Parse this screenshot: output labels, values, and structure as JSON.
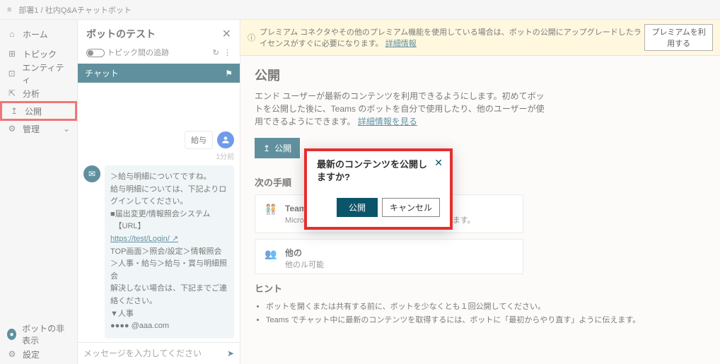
{
  "breadcrumb": "部署1 / 社内Q&Aチャットボット",
  "nav": [
    {
      "icon": "⌂",
      "label": "ホーム"
    },
    {
      "icon": "⊞",
      "label": "トピック"
    },
    {
      "icon": "⊡",
      "label": "エンティティ"
    },
    {
      "icon": "⇱",
      "label": "分析"
    },
    {
      "icon": "↥",
      "label": "公開"
    },
    {
      "icon": "⚙",
      "label": "管理"
    }
  ],
  "nav_bottom": [
    {
      "icon": "●",
      "label": "ボットの非表示"
    },
    {
      "icon": "⚙",
      "label": "設定"
    }
  ],
  "test_panel": {
    "title": "ボットのテスト",
    "track_label": "トピック間の追跡",
    "chat_tab": "チャット",
    "user_msg": "給与",
    "user_ts": "1分前",
    "bot_lines": [
      "＞給与明細についてですね。",
      "給与明細については、下記よりログインしてください。",
      "■届出変更/情報照会システム",
      "　【URL】",
      "https://test/Login/ ↗",
      "TOP画面＞照会/設定＞情報照会＞人事・給与＞給与・賞与明細照会",
      "",
      "解決しない場合は、下記までご連絡ください。",
      "▼人事",
      "●●●● @aaa.com"
    ],
    "input_placeholder": "メッセージを入力してください"
  },
  "banner": {
    "text": "プレミアム コネクタやその他のプレミアム機能を使用している場合は、ボットの公開にアップグレードしたライセンスがすぐに必要になります。",
    "link": "詳細情報",
    "button": "プレミアムを利用する"
  },
  "page": {
    "title": "公開",
    "desc": "エンド ユーザーが最新のコンテンツを利用できるようにします。初めてボットを公開した後に、Teams のボットを自分で使用したり、他のユーザーが使用できるようにできます。",
    "desc_link": "詳細情報を見る",
    "publish_btn": "公開",
    "next_steps": "次の手順",
    "card1_title": "Teams でボットを開く",
    "card1_sub": "Microsoft Teams でボットとのチャットを開始します。",
    "card2_title": "他の",
    "card2_sub": "他のル可能",
    "hints_title": "ヒント",
    "hints": [
      "ボットを開くまたは共有する前に、ボットを少なくとも１回公開してください。",
      "Teams でチャット中に最新のコンテンツを取得するには、ボットに「最初からやり直す」ように伝えます。"
    ]
  },
  "dialog": {
    "title": "最新のコンテンツを公開しますか?",
    "ok": "公開",
    "cancel": "キャンセル"
  }
}
